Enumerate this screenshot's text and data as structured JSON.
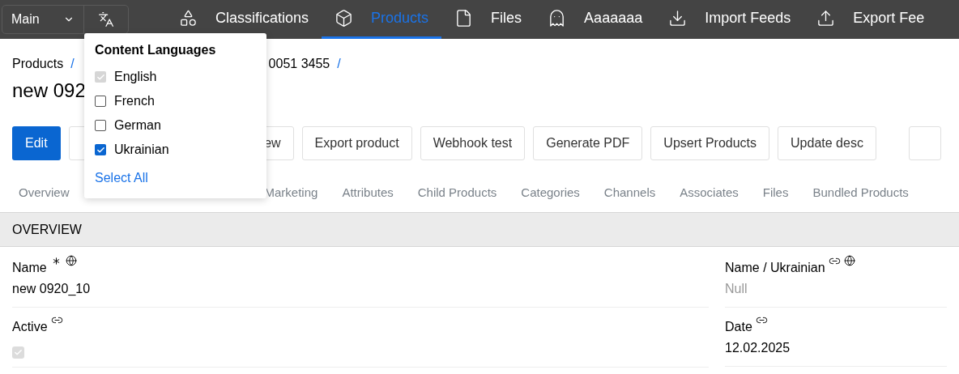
{
  "navbar": {
    "scope_select": {
      "value": "Main"
    },
    "items": [
      {
        "label": "Classifications",
        "selected": false
      },
      {
        "label": "Products",
        "selected": true
      },
      {
        "label": "Files",
        "selected": false
      },
      {
        "label": "Aaaaaaa",
        "selected": false
      },
      {
        "label": "Import Feeds",
        "selected": false
      },
      {
        "label": "Export Fee",
        "selected": false
      }
    ]
  },
  "language_menu": {
    "title": "Content Languages",
    "options": [
      {
        "label": "English",
        "checked": true,
        "disabled": true
      },
      {
        "label": "French",
        "checked": false,
        "disabled": false
      },
      {
        "label": "German",
        "checked": false,
        "disabled": false
      },
      {
        "label": "Ukrainian",
        "checked": true,
        "disabled": false
      }
    ],
    "select_all": "Select All"
  },
  "breadcrumb": {
    "first": "Products",
    "separator": "/",
    "last": "0051 3455",
    "trailing": "/"
  },
  "title": "new 092",
  "actions": [
    {
      "label": "Edit",
      "kind": "primary"
    },
    {
      "label": "ew",
      "kind": "right"
    },
    {
      "label": "Export product",
      "kind": "normal"
    },
    {
      "label": "Webhook test",
      "kind": "normal"
    },
    {
      "label": "Generate PDF",
      "kind": "normal"
    },
    {
      "label": "Upsert Products",
      "kind": "normal"
    },
    {
      "label": "Update desc",
      "kind": "normal"
    }
  ],
  "tabs_left": [
    "Overview"
  ],
  "tabs_right": [
    "Marketing",
    "Attributes",
    "Child Products",
    "Categories",
    "Channels",
    "Associates",
    "Files",
    "Bundled Products"
  ],
  "section": {
    "title": "OVERVIEW",
    "left_fields": [
      {
        "label": "Name",
        "required": true,
        "link": false,
        "globe": true,
        "kind": "text",
        "value": "new 0920_10"
      },
      {
        "label": "Active",
        "required": false,
        "link": true,
        "globe": false,
        "kind": "checkbox",
        "checked": true
      }
    ],
    "right_fields": [
      {
        "label": "Name / Ukrainian",
        "required": false,
        "link": true,
        "globe": true,
        "kind": "null",
        "value": "Null"
      },
      {
        "label": "Date",
        "required": false,
        "link": true,
        "globe": false,
        "kind": "text",
        "value": "12.02.2025"
      }
    ]
  }
}
